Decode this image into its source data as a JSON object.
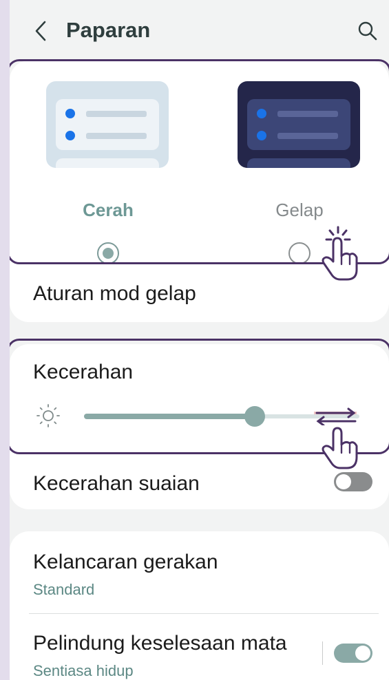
{
  "header": {
    "title": "Paparan",
    "back_icon": "chevron-left-icon",
    "search_icon": "search-icon"
  },
  "theme": {
    "options": [
      {
        "label": "Cerah",
        "selected": true
      },
      {
        "label": "Gelap",
        "selected": false
      }
    ],
    "dark_mode_rules_label": "Aturan mod gelap"
  },
  "brightness": {
    "title": "Kecerahan",
    "level": 0.62,
    "adaptive_label": "Kecerahan suaian",
    "adaptive_on": false
  },
  "settings": {
    "motion_smoothness_label": "Kelancaran gerakan",
    "motion_smoothness_value": "Standard",
    "eye_comfort_label": "Pelindung keselesaan mata",
    "eye_comfort_value": "Sentiasa hidup",
    "eye_comfort_on": true
  },
  "colors": {
    "accent": "#8aa9a6",
    "highlight_frame": "#4b3266",
    "dark_preview": "#24264a"
  }
}
